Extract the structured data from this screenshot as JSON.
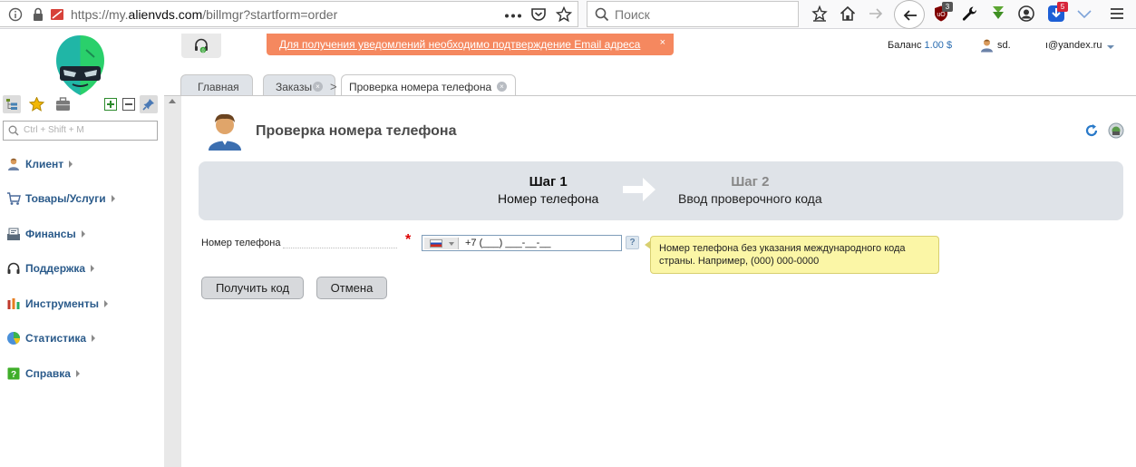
{
  "browser": {
    "url_prefix": "https://my.",
    "url_host": "alienvds.com",
    "url_path": "/billmgr?startform=order",
    "search_placeholder": "Поиск",
    "ublock_badge": "3",
    "addon_badge": "5"
  },
  "header": {
    "notification": "Для получения уведомлений необходимо подтверждение Email адреса",
    "notification_close": "×",
    "balance_label": "Баланс",
    "balance_value": "1.00 $",
    "user": "sd.",
    "email": "ı@yandex.ru"
  },
  "sidebar": {
    "search_placeholder": "Ctrl + Shift + M",
    "items": [
      {
        "label": "Клиент",
        "icon": "client-icon"
      },
      {
        "label": "Товары/Услуги",
        "icon": "cart-icon"
      },
      {
        "label": "Финансы",
        "icon": "finance-icon"
      },
      {
        "label": "Поддержка",
        "icon": "headset-icon"
      },
      {
        "label": "Инструменты",
        "icon": "tools-icon"
      },
      {
        "label": "Статистика",
        "icon": "chart-icon"
      },
      {
        "label": "Справка",
        "icon": "help-book-icon"
      }
    ]
  },
  "tabs": [
    {
      "label": "Главная"
    },
    {
      "label": "Заказы"
    },
    {
      "label": "Проверка номера телефона"
    }
  ],
  "main": {
    "title": "Проверка номера телефона",
    "steps": [
      {
        "title": "Шаг 1",
        "desc": "Номер телефона"
      },
      {
        "title": "Шаг 2",
        "desc": "Ввод проверочного кода"
      }
    ],
    "phone_label": "Номер телефона",
    "required_mark": "*",
    "phone_value": "+7 (___) ___-__-__",
    "help_mark": "?",
    "hint": "Номер телефона без указания международного кода страны. Например, (000) 000-0000",
    "get_code_button": "Получить код",
    "cancel_button": "Отмена"
  },
  "colors": {
    "notification_bg": "#f5885f",
    "menu_text": "#2a5a8a",
    "steps_bg": "#dfe3e8",
    "hint_bg": "#fbf6a6"
  }
}
